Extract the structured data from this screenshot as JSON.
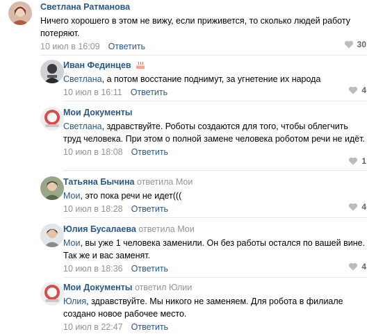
{
  "comments": [
    {
      "author": "Светлана Ратманова",
      "answered": "",
      "answered_to": "",
      "mention": "",
      "text": "Ничего хорошего в этом не вижу, если приживется, то сколько людей работу потеряют.",
      "date": "10 июл в 16:09",
      "reply_label": "Ответить",
      "likes": "30"
    },
    {
      "author": "Иван Фединцев",
      "answered": "",
      "answered_to": "",
      "mention": "Светлана",
      "text": ", а потом восстание поднимут, за угнетение их народа",
      "date": "10 июл в 16:11",
      "reply_label": "Ответить",
      "likes": "4",
      "emoji": "cake-icon"
    },
    {
      "author": "Мои Документы",
      "answered": "",
      "answered_to": "",
      "mention": "Светлана",
      "text": ", здравствуйте. Роботы создаются для того, чтобы облегчить труд человека. При этом о полной замене человека роботом речи не идёт.",
      "date": "10 июл в 18:08",
      "reply_label": "Ответить",
      "likes": "1"
    },
    {
      "author": "Татьяна Бычина",
      "answered": "ответила",
      "answered_to": "Мои",
      "mention": "Мои",
      "text": ", это пока речи не идет(((",
      "date": "10 июл в 18:28",
      "reply_label": "Ответить",
      "likes": "4"
    },
    {
      "author": "Юлия Бусалаева",
      "answered": "ответила",
      "answered_to": "Мои",
      "mention": "Мои",
      "text": ", вы уже 1 человека заменили. Он без работы остался по вашей вине. Так же и вас заменят.",
      "date": "10 июл в 18:36",
      "reply_label": "Ответить",
      "likes": "4"
    },
    {
      "author": "Мои Документы",
      "answered": "ответил",
      "answered_to": "Юлии",
      "mention": "Юлия",
      "text": ", здравствуйте. Мы никого не заменяем. Для робота в филиале создано новое рабочее место.",
      "date": "10 июл в 22:47",
      "reply_label": "Ответить",
      "likes": ""
    }
  ],
  "colors": {
    "link": "#2a5885",
    "muted": "#939393",
    "divider": "#e7e8ec",
    "likes": "#656565"
  },
  "icons": {
    "like": "heart-icon"
  }
}
